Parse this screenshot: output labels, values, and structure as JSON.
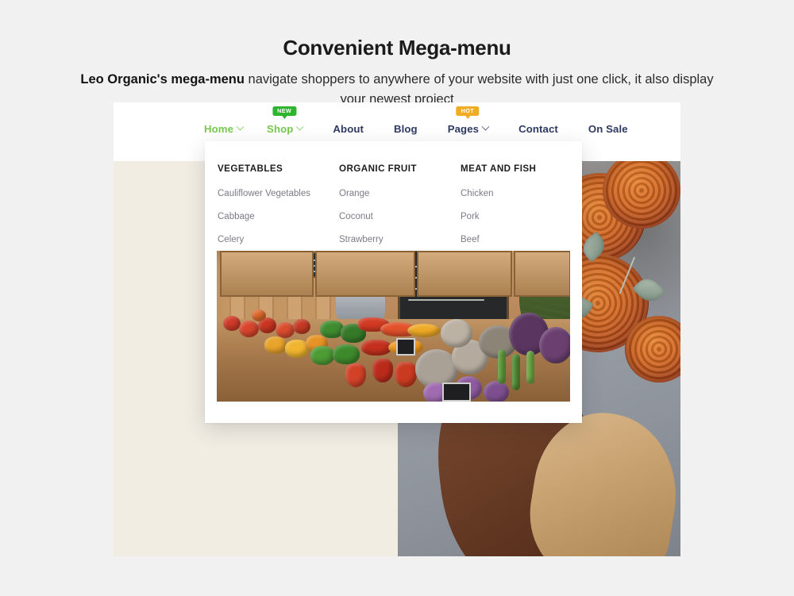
{
  "heading": {
    "title": "Convenient Mega-menu",
    "subtitle_lead": "Leo Organic's mega-menu",
    "subtitle_rest": " navigate shoppers to anywhere of your website with just one click, it also display your newest project"
  },
  "colors": {
    "page_background": "#f1f1f1",
    "nav_background": "#ffffff",
    "nav_link": "#2e3a62",
    "nav_link_accent": "#78c850",
    "badge_new_background": "#2db52d",
    "badge_hot_background": "#f0ad23",
    "menu_background": "#ffffff",
    "menu_title": "#1d1d1f",
    "menu_link": "#7b7b87",
    "panel_left_background": "#f2ede3"
  },
  "navbar": {
    "items": [
      {
        "label": "Home",
        "accent": true,
        "has_caret": true,
        "badge": null
      },
      {
        "label": "Shop",
        "accent": true,
        "has_caret": true,
        "badge": "NEW"
      },
      {
        "label": "About",
        "accent": false,
        "has_caret": false,
        "badge": null
      },
      {
        "label": "Blog",
        "accent": false,
        "has_caret": false,
        "badge": null
      },
      {
        "label": "Pages",
        "accent": false,
        "has_caret": true,
        "badge": "HOT"
      },
      {
        "label": "Contact",
        "accent": false,
        "has_caret": false,
        "badge": null
      },
      {
        "label": "On Sale",
        "accent": false,
        "has_caret": false,
        "badge": null
      }
    ]
  },
  "megamenu": {
    "columns": [
      {
        "title": "VEGETABLES",
        "links": [
          "Cauliflower Vegetables",
          "Cabbage",
          "Celery"
        ]
      },
      {
        "title": "ORGANIC FRUIT",
        "links": [
          "Orange",
          "Coconut",
          "Strawberry"
        ]
      },
      {
        "title": "MEAT AND FISH",
        "links": [
          "Chicken",
          "Pork",
          "Beef"
        ]
      }
    ],
    "promo_image_alt": "farm-stand-produce-photo"
  },
  "hero": {
    "image_alt": "person-holding-orange-dahlia-bouquet"
  }
}
